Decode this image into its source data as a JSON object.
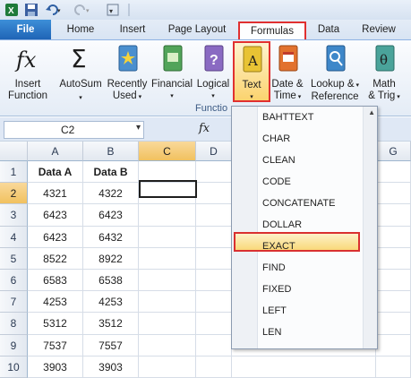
{
  "tabs": [
    "File",
    "Home",
    "Insert",
    "Page Layout",
    "Formulas",
    "Data",
    "Review"
  ],
  "ribbon": {
    "buttons": [
      {
        "line1": "Insert",
        "line2": "Function"
      },
      {
        "line1": "AutoSum",
        "line2": ""
      },
      {
        "line1": "Recently",
        "line2": "Used"
      },
      {
        "line1": "Financial",
        "line2": ""
      },
      {
        "line1": "Logical",
        "line2": ""
      },
      {
        "line1": "Text",
        "line2": ""
      },
      {
        "line1": "Date &",
        "line2": "Time"
      },
      {
        "line1": "Lookup &",
        "line2": "Reference"
      },
      {
        "line1": "Math",
        "line2": "& Trig"
      }
    ],
    "group_label": "Functio"
  },
  "formula_bar": {
    "name_box": "C2",
    "fx_label": "fx",
    "formula": ""
  },
  "grid": {
    "columns": [
      "A",
      "B",
      "C",
      "D",
      "G"
    ],
    "rows": [
      "1",
      "2",
      "3",
      "4",
      "5",
      "6",
      "7",
      "8",
      "9",
      "10"
    ],
    "data": [
      [
        "Data A",
        "Data B"
      ],
      [
        "4321",
        "4322"
      ],
      [
        "6423",
        "6423"
      ],
      [
        "6423",
        "6432"
      ],
      [
        "8522",
        "8922"
      ],
      [
        "6583",
        "6538"
      ],
      [
        "4253",
        "4253"
      ],
      [
        "5312",
        "3512"
      ],
      [
        "7537",
        "7557"
      ],
      [
        "3903",
        "3903"
      ]
    ],
    "active_cell": "C2"
  },
  "text_menu": {
    "items": [
      "BAHTTEXT",
      "CHAR",
      "CLEAN",
      "CODE",
      "CONCATENATE",
      "DOLLAR",
      "EXACT",
      "FIND",
      "FIXED",
      "LEFT",
      "LEN"
    ],
    "highlighted": "EXACT"
  },
  "colors": {
    "accent_red": "#e03030",
    "file_tab": "#2a72c5",
    "highlight": "#f9d97a"
  }
}
